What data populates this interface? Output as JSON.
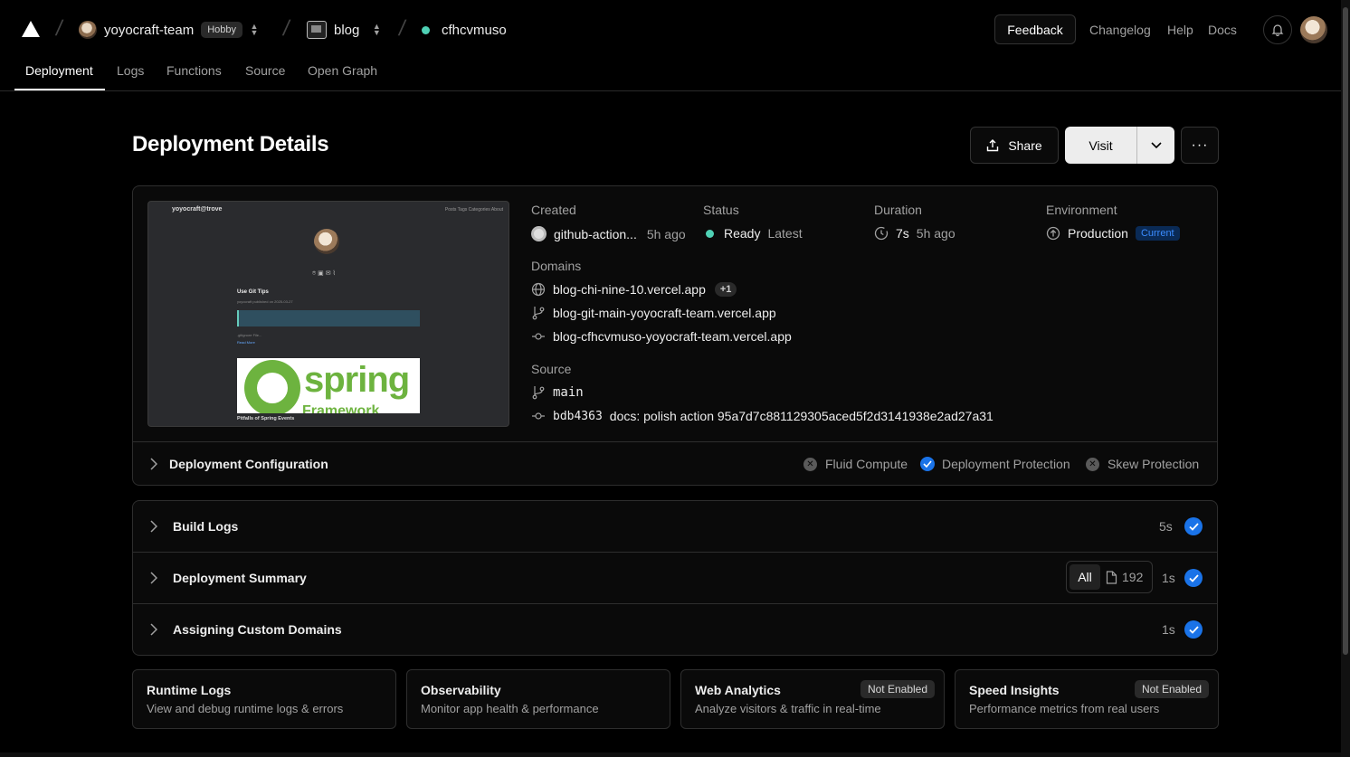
{
  "header": {
    "team": "yoyocraft-team",
    "plan": "Hobby",
    "project": "blog",
    "deployment": "cfhcvmuso",
    "feedback": "Feedback",
    "links": [
      "Changelog",
      "Help",
      "Docs"
    ]
  },
  "tabs": [
    "Deployment",
    "Logs",
    "Functions",
    "Source",
    "Open Graph"
  ],
  "page": {
    "title": "Deployment Details",
    "share": "Share",
    "visit": "Visit"
  },
  "preview": {
    "site": "yoyocraft@trove",
    "nav": "Posts   Tags   Categories   About",
    "post_title": "Use Git Tips",
    "post_meta": "yoyocraft published on 2025-03-27",
    "gitignore": ".gitignore File...",
    "read_more": "Read More",
    "logo_word": "spring",
    "logo_sub": "Framework",
    "caption": "Pitfalls of Spring Events"
  },
  "details": {
    "created_label": "Created",
    "created_by": "github-action...",
    "created_ago": "5h ago",
    "status_label": "Status",
    "status": "Ready",
    "status_tag": "Latest",
    "duration_label": "Duration",
    "duration": "7s",
    "duration_ago": "5h ago",
    "env_label": "Environment",
    "env": "Production",
    "env_badge": "Current",
    "domains_label": "Domains",
    "domains": [
      "blog-chi-nine-10.vercel.app",
      "blog-git-main-yoyocraft-team.vercel.app",
      "blog-cfhcvmuso-yoyocraft-team.vercel.app"
    ],
    "domains_extra": "+1",
    "source_label": "Source",
    "branch": "main",
    "commit_sha": "bdb4363",
    "commit_msg": "docs: polish action 95a7d7c881129305aced5f2d3141938e2ad27a31"
  },
  "config": {
    "title": "Deployment Configuration",
    "features": [
      {
        "label": "Fluid Compute",
        "enabled": false
      },
      {
        "label": "Deployment Protection",
        "enabled": true
      },
      {
        "label": "Skew Protection",
        "enabled": false
      }
    ]
  },
  "logs": [
    {
      "title": "Build Logs",
      "time": "5s"
    },
    {
      "title": "Deployment Summary",
      "time": "1s",
      "filter": "All",
      "count": "192"
    },
    {
      "title": "Assigning Custom Domains",
      "time": "1s"
    }
  ],
  "cards": [
    {
      "title": "Runtime Logs",
      "sub": "View and debug runtime logs & errors",
      "badge": ""
    },
    {
      "title": "Observability",
      "sub": "Monitor app health & performance",
      "badge": ""
    },
    {
      "title": "Web Analytics",
      "sub": "Analyze visitors & traffic in real-time",
      "badge": "Not Enabled"
    },
    {
      "title": "Speed Insights",
      "sub": "Performance metrics from real users",
      "badge": "Not Enabled"
    }
  ]
}
